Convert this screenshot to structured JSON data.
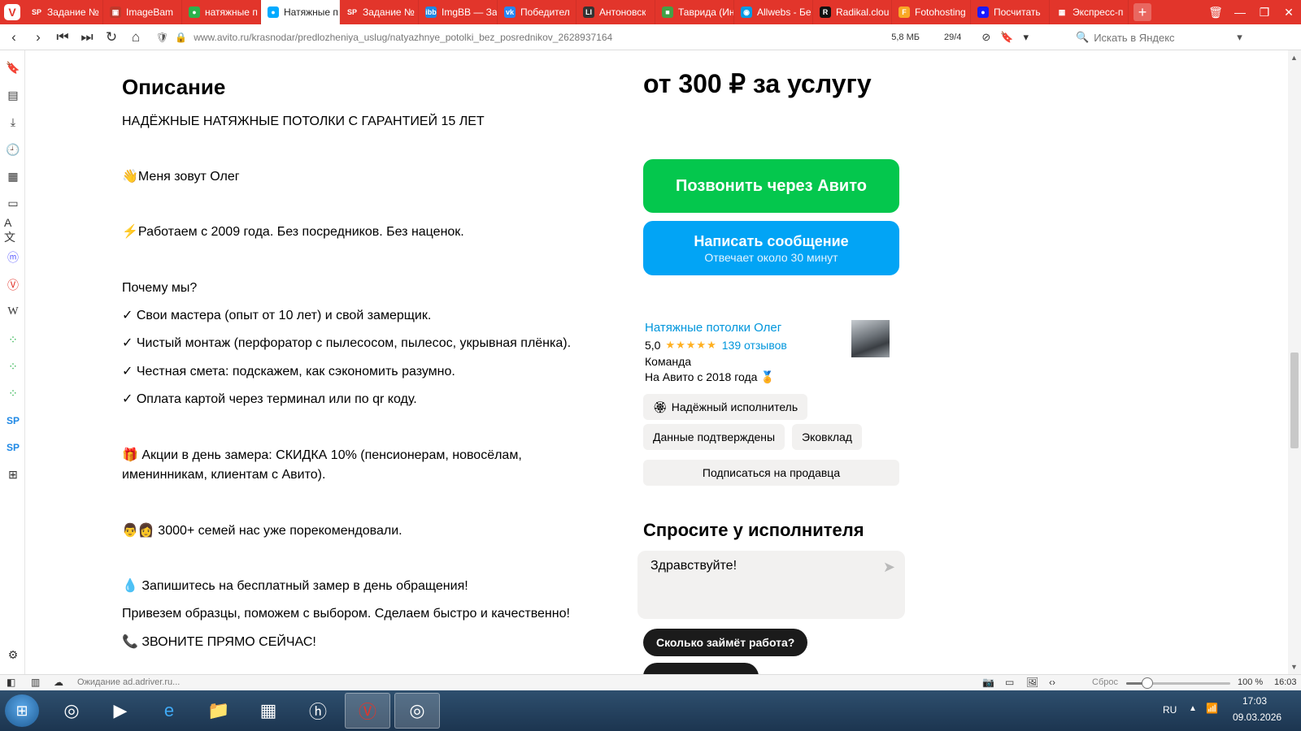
{
  "tabs": [
    {
      "title": "Задание №",
      "favicon": "SP",
      "fav_color": "#e2352b",
      "active": false
    },
    {
      "title": "ImageBam",
      "favicon": "▣",
      "fav_color": "#c0392b",
      "active": false
    },
    {
      "title": "натяжные п",
      "favicon": "●",
      "fav_color": "#2bb24c",
      "active": false
    },
    {
      "title": "Натяжные п",
      "favicon": "●",
      "fav_color": "#00aaff",
      "active": true
    },
    {
      "title": "Задание №",
      "favicon": "SP",
      "fav_color": "#e2352b",
      "active": false
    },
    {
      "title": "ImgBB — За",
      "favicon": "ibb",
      "fav_color": "#1e88e5",
      "active": false
    },
    {
      "title": "Победител",
      "favicon": "vk",
      "fav_color": "#2787f5",
      "active": false
    },
    {
      "title": "Антоновск",
      "favicon": "LI",
      "fav_color": "#333333",
      "active": false
    },
    {
      "title": "Таврида (Ин",
      "favicon": "■",
      "fav_color": "#43a047",
      "active": false
    },
    {
      "title": "Allwebs - Бе",
      "favicon": "◉",
      "fav_color": "#039be5",
      "active": false
    },
    {
      "title": "Radikal.clou",
      "favicon": "R",
      "fav_color": "#111111",
      "active": false
    },
    {
      "title": "Fotohosting",
      "favicon": "F",
      "fav_color": "#f9a825",
      "active": false
    },
    {
      "title": "Посчитать",
      "favicon": "●",
      "fav_color": "#1a1aff",
      "active": false
    },
    {
      "title": "Экспресс-п",
      "favicon": "▦",
      "fav_color": "#e2352b",
      "active": false
    }
  ],
  "address": {
    "url": "www.avito.ru/krasnodar/predlozheniya_uslug/natyazhnye_potolki_bez_posrednikov_2628937164",
    "page_size": "5,8 МБ",
    "tab_counter": "29/4",
    "search_placeholder": "Искать в Яндекс"
  },
  "description": {
    "title": "Описание",
    "lines": [
      "НАДЁЖНЫЕ НАТЯЖНЫЕ ПОТОЛКИ С ГАРАНТИЕЙ 15 ЛЕТ",
      "👋Меня зовут Олег",
      "⚡Работаем с 2009 года. Без посредников. Без наценок.",
      "Почему мы?",
      "✓ Свои мастера (опыт от 10 лет) и свой замерщик.",
      "✓ Чистый монтаж (перфоратор с пылесосом, пылесос, укрывная плёнка).",
      "✓ Честная смета: подскажем, как сэкономить разумно.",
      "✓ Оплата картой через терминал или по qr коду.",
      "🎁 Акции в день замера: СКИДКА 10% (пенсионерам, новосёлам,",
      "именинникам, клиентам с Авито).",
      "👨‍👩 3000+ семей нас уже порекомендовали.",
      "💧 Запишитесь на бесплатный замер в день обращения!",
      "Привезем образцы, поможем с выбором. Сделаем быстро и качественно!",
      "📞 ЗВОНИТЕ ПРЯМО СЕЙЧАС!"
    ]
  },
  "offer": {
    "price": "от 300 ₽ за услугу",
    "call_button": "Позвонить через Авито",
    "message_button": "Написать сообщение",
    "message_subtitle": "Отвечает около 30 минут"
  },
  "seller": {
    "name": "Натяжные потолки Олег",
    "rating": "5,0",
    "stars": "★★★★★",
    "reviews": "139 отзывов",
    "type": "Команда",
    "since": "На Авито с 2018 года 🏅",
    "badge_reliable": "Надёжный исполнитель",
    "badge_verified": "Данные подтверждены",
    "badge_ecodeposit": "Эковклад",
    "subscribe": "Подписаться на продавца"
  },
  "ask": {
    "title": "Спросите у исполнителя",
    "message_value": "Здравствуйте!",
    "quick_question_1": "Сколько займёт работа?"
  },
  "status": {
    "loading_text": "Ожидание ad.adriver.ru...",
    "zoom_reset": "Сброс",
    "zoom_level": "100 %",
    "zoom_fraction": 0.2,
    "time_small": "16:03"
  },
  "taskbar": {
    "lang": "RU",
    "time": "17:03",
    "date": "09.03.2026"
  }
}
